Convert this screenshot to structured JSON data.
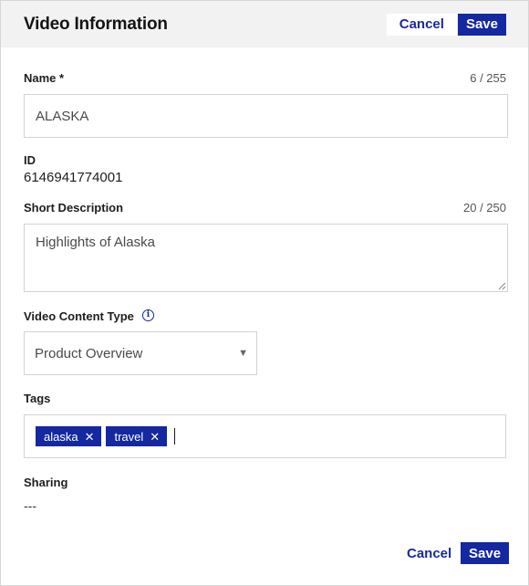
{
  "header": {
    "title": "Video Information",
    "cancel_label": "Cancel",
    "save_label": "Save"
  },
  "name_field": {
    "label": "Name *",
    "counter": "6 / 255",
    "value": "ALASKA"
  },
  "id_field": {
    "label": "ID",
    "value": "6146941774001"
  },
  "description_field": {
    "label": "Short Description",
    "counter": "20 / 250",
    "value": "Highlights of Alaska"
  },
  "content_type": {
    "label": "Video Content Type",
    "info_icon": "info-icon",
    "selected": "Product Overview",
    "caret": "▼"
  },
  "tags": {
    "label": "Tags",
    "items": [
      {
        "label": "alaska",
        "remove": "✕"
      },
      {
        "label": "travel",
        "remove": "✕"
      }
    ]
  },
  "sharing": {
    "label": "Sharing",
    "value": "---"
  },
  "footer": {
    "cancel_label": "Cancel",
    "save_label": "Save"
  },
  "colors": {
    "accent": "#1428a0",
    "header_bg": "#f2f2f2",
    "border": "#d3d3d3"
  }
}
